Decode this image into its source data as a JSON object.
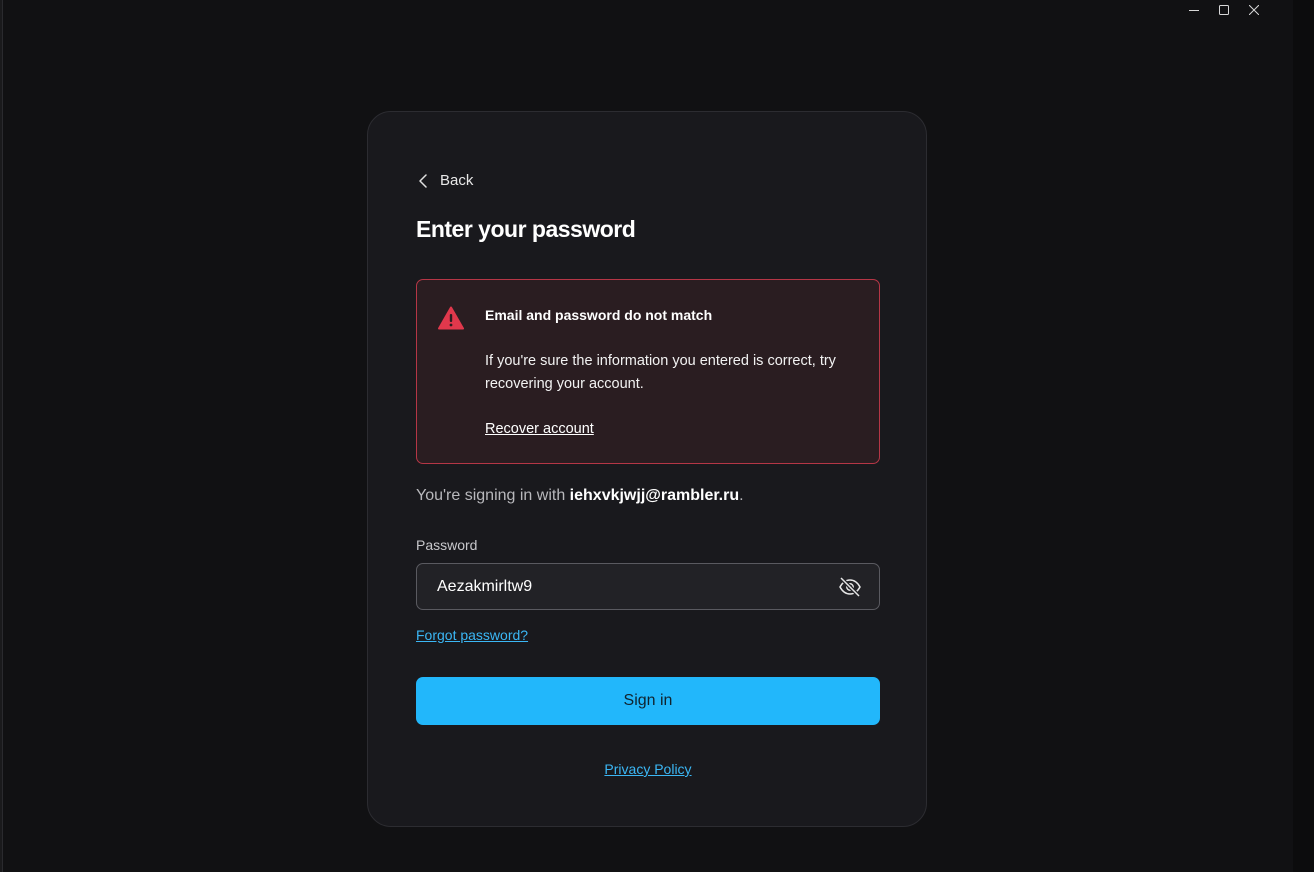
{
  "window": {
    "controls": {
      "minimize_icon": "minimize-icon",
      "maximize_icon": "maximize-icon",
      "close_icon": "close-icon"
    }
  },
  "login": {
    "back_label": "Back",
    "title": "Enter your password",
    "alert": {
      "title": "Email and password do not match",
      "body": "If you're sure the information you entered is correct, try recovering your account.",
      "link": "Recover account",
      "icon": "warning-icon",
      "color": "#e0384c"
    },
    "signing_prefix": "You're signing in with ",
    "email": "iehxvkjwjj@rambler.ru",
    "signing_suffix": ".",
    "password_label": "Password",
    "password_value": "Aezakmirltw9",
    "visibility_icon": "eye-off-icon",
    "forgot_label": "Forgot password?",
    "signin_label": "Sign in",
    "privacy_label": "Privacy Policy"
  },
  "colors": {
    "accent": "#22b7fb",
    "link": "#3bb7f5",
    "background": "#111113",
    "card": "#19191d",
    "error_border": "#b53646"
  }
}
